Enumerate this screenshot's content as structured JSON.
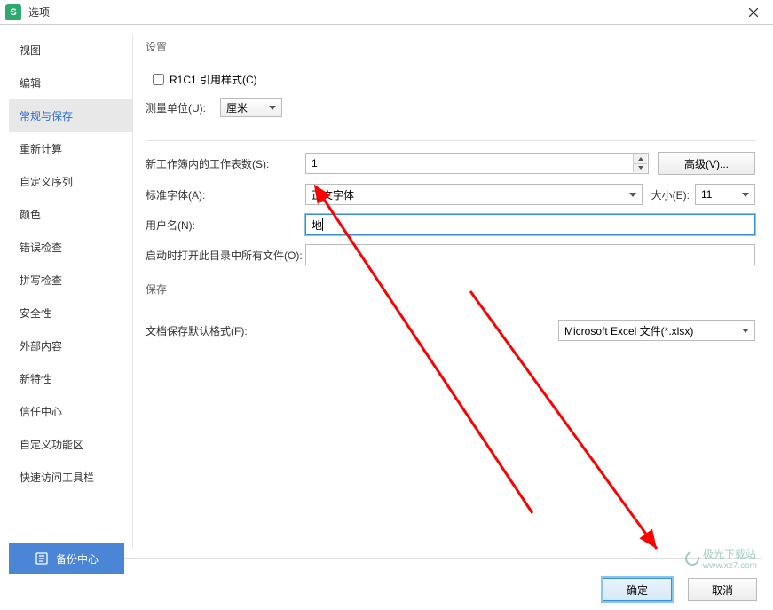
{
  "window": {
    "title": "选项"
  },
  "sidebar": {
    "items": [
      {
        "label": "视图"
      },
      {
        "label": "编辑"
      },
      {
        "label": "常规与保存",
        "active": true
      },
      {
        "label": "重新计算"
      },
      {
        "label": "自定义序列"
      },
      {
        "label": "颜色"
      },
      {
        "label": "错误检查"
      },
      {
        "label": "拼写检查"
      },
      {
        "label": "安全性"
      },
      {
        "label": "外部内容"
      },
      {
        "label": "新特性"
      },
      {
        "label": "信任中心"
      },
      {
        "label": "自定义功能区"
      },
      {
        "label": "快速访问工具栏"
      }
    ]
  },
  "settings_section": {
    "title": "设置",
    "r1c1_label": "R1C1 引用样式(C)",
    "unit_label": "测量单位(U):",
    "unit_value": "厘米"
  },
  "worksheet_section": {
    "sheets_label": "新工作簿内的工作表数(S):",
    "sheets_value": "1",
    "advanced_button": "高级(V)...",
    "font_label": "标准字体(A):",
    "font_value": "正文字体",
    "size_label": "大小(E):",
    "size_value": "11",
    "username_label": "用户名(N):",
    "username_value": "地",
    "startup_label": "启动时打开此目录中所有文件(O):",
    "startup_value": ""
  },
  "save_section": {
    "title": "保存",
    "default_format_label": "文档保存默认格式(F):",
    "default_format_value": "Microsoft Excel 文件(*.xlsx)"
  },
  "footer": {
    "backup_button": "备份中心",
    "ok_button": "确定",
    "cancel_button": "取消"
  },
  "watermark": {
    "text": "极光下载站",
    "url": "www.xz7.com"
  }
}
